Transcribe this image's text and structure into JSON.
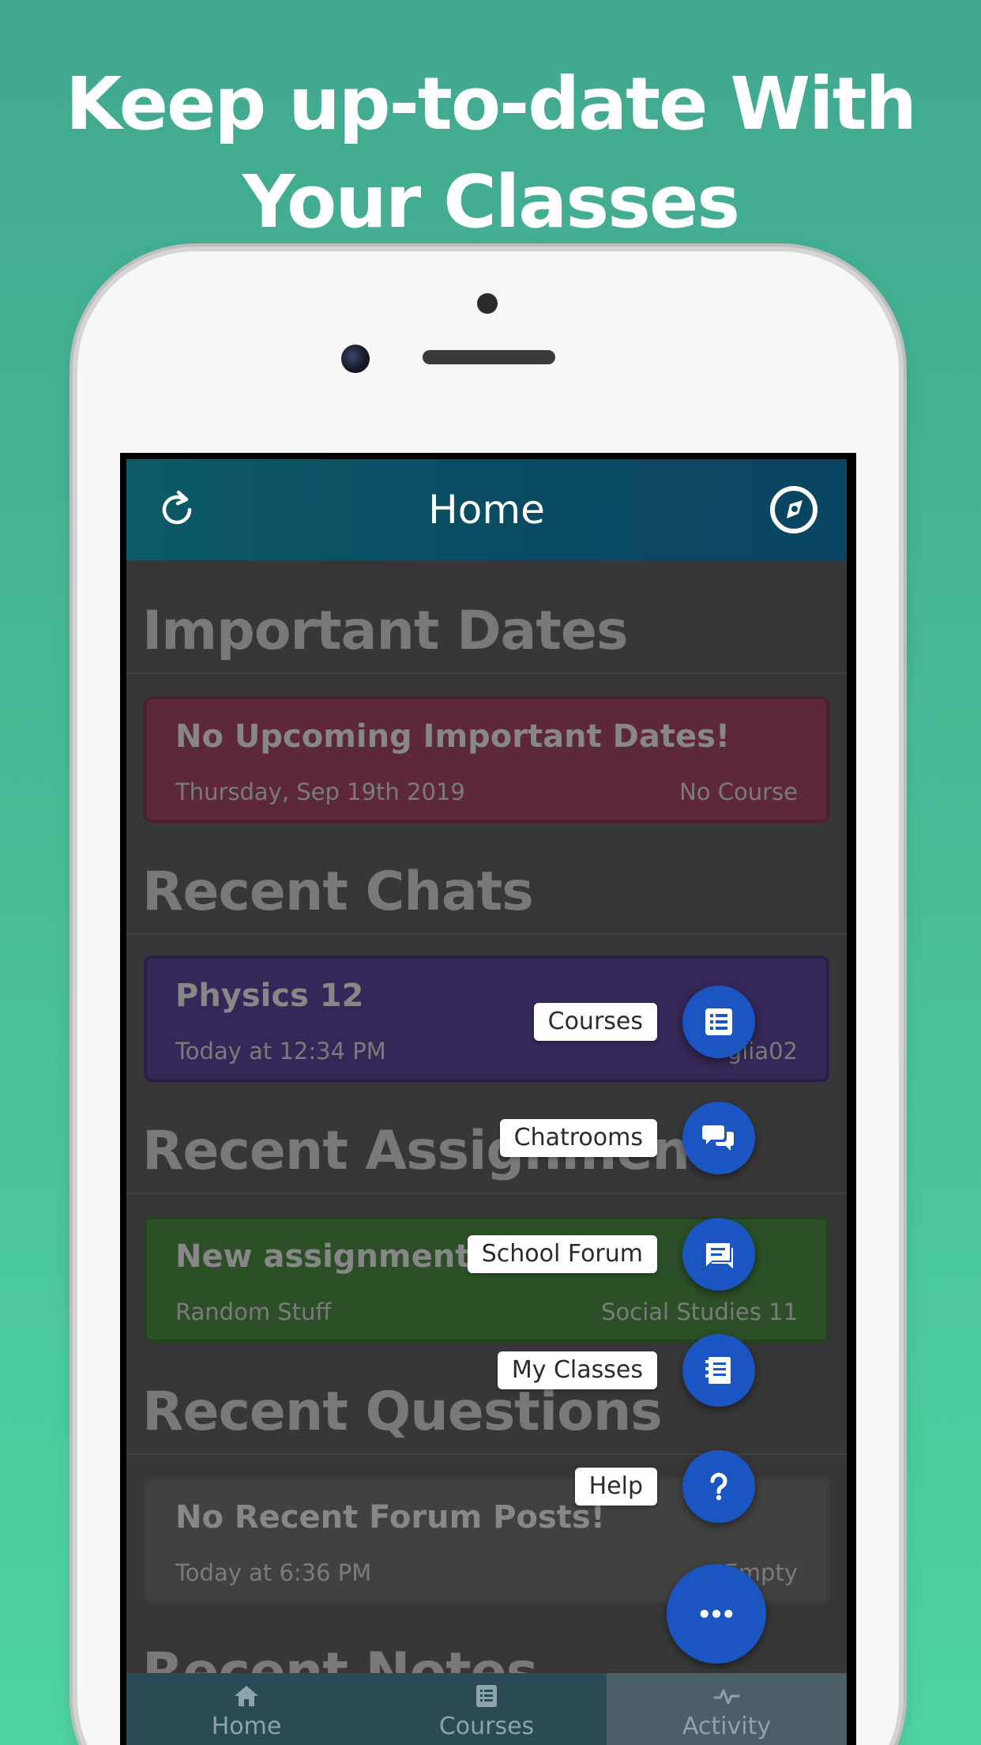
{
  "headline": "Keep up-to-date With Your Classes",
  "navbar": {
    "title": "Home",
    "refresh_icon": "refresh-icon",
    "compass_icon": "compass-icon",
    "bar_color": "#0a4a63"
  },
  "sections": {
    "important_dates": {
      "title": "Important Dates",
      "card": {
        "title": "No Upcoming Important Dates!",
        "date": "Thursday, Sep 19th 2019",
        "course": "No Course",
        "color": "#6a2e3f"
      }
    },
    "recent_chats": {
      "title": "Recent Chats",
      "card": {
        "title": "Physics 12",
        "time": "Today at 12:34 PM",
        "user_fragment": "glia02",
        "color": "#3d2d63"
      }
    },
    "recent_assignments": {
      "title": "Recent Assignments",
      "card": {
        "title": "New assignment!",
        "subtitle": "Random Stuff",
        "course": "Social Studies 11",
        "color": "#335a2e"
      }
    },
    "recent_questions": {
      "title": "Recent Questions",
      "card": {
        "title": "No Recent Forum Posts!",
        "time": "Today at 6:36 PM",
        "status": "Empty",
        "color": "#4a4a4c"
      }
    },
    "recent_notes": {
      "title": "Recent Notes"
    }
  },
  "fab_menu": {
    "items": [
      {
        "label": "Courses",
        "icon": "list-icon"
      },
      {
        "label": "Chatrooms",
        "icon": "chat-bubbles-icon"
      },
      {
        "label": "School Forum",
        "icon": "forum-icon"
      },
      {
        "label": "My Classes",
        "icon": "notebook-icon"
      },
      {
        "label": "Help",
        "icon": "question-icon"
      }
    ],
    "main_icon": "more-dots-icon",
    "fab_color": "#1a55c2"
  },
  "tabbar": {
    "tabs": [
      {
        "label": "Home",
        "icon": "home-icon",
        "active": false
      },
      {
        "label": "Courses",
        "icon": "list-icon",
        "active": false
      },
      {
        "label": "Activity",
        "icon": "activity-icon",
        "active": true
      }
    ]
  }
}
